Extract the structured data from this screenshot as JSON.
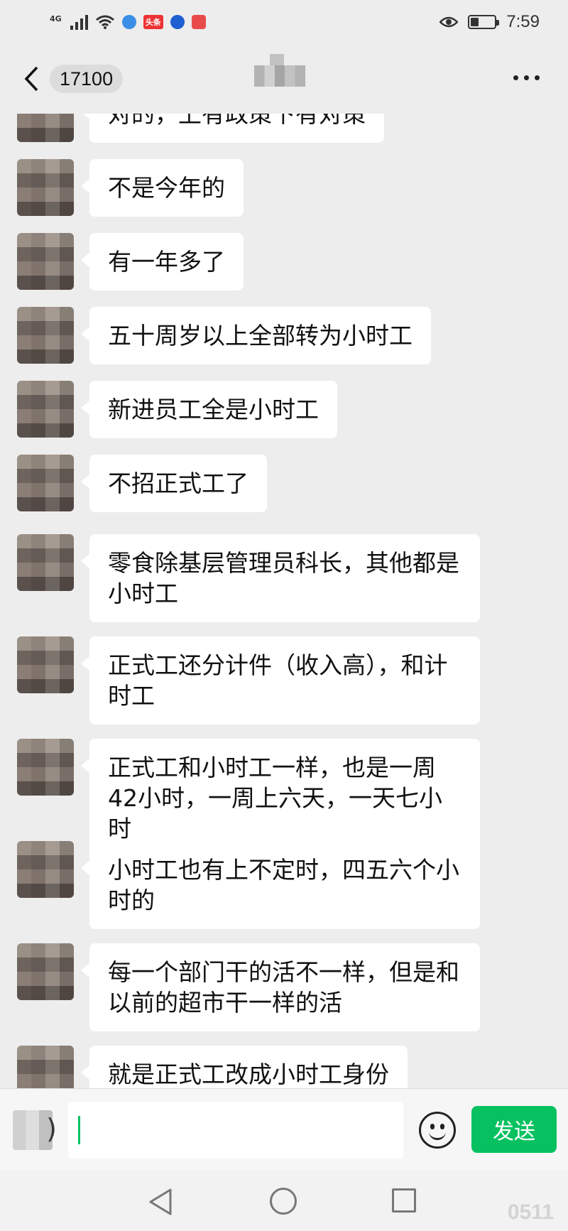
{
  "status_bar": {
    "network": "4G",
    "app_badge": "头条",
    "time": "7:59",
    "battery_level": 0.35
  },
  "header": {
    "unread_count": "17100"
  },
  "messages": [
    {
      "text": "对的，上有政策下有对策"
    },
    {
      "text": "不是今年的"
    },
    {
      "text": "有一年多了"
    },
    {
      "text": "五十周岁以上全部转为小时工"
    },
    {
      "text": "新进员工全是小时工"
    },
    {
      "text": "不招正式工了"
    },
    {
      "text": "零食除基层管理员科长，其他都是小时工"
    },
    {
      "text": "正式工还分计件（收入高），和计时工"
    },
    {
      "text": "正式工和小时工一样，也是一周42小时，一周上六天，一天七小时"
    },
    {
      "text": "小时工也有上不定时，四五六个小时的"
    },
    {
      "text": "每一个部门干的活不一样，但是和以前的超市干一样的活"
    },
    {
      "text": "就是正式工改成小时工身份"
    }
  ],
  "input_bar": {
    "send_label": "发送"
  },
  "watermark": "0511"
}
